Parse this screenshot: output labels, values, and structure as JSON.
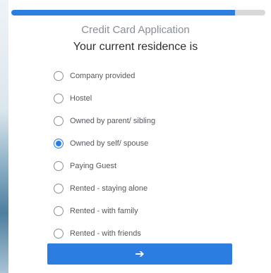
{
  "progress": {
    "fraction": 0.88,
    "color": "#2b7de2"
  },
  "header": {
    "app_title": "Credit Card Application",
    "question": "Your current residence is"
  },
  "options": [
    {
      "label": "Company provided",
      "selected": false
    },
    {
      "label": "Hostel",
      "selected": false
    },
    {
      "label": "Owned by parent/ sibling",
      "selected": false
    },
    {
      "label": "Owned by self/ spouse",
      "selected": true
    },
    {
      "label": "Paying Guest",
      "selected": false
    },
    {
      "label": "Rented - staying alone",
      "selected": false
    },
    {
      "label": "Rented - with family",
      "selected": false
    },
    {
      "label": "Rented - with friends",
      "selected": false
    }
  ],
  "next_button": {
    "icon": "arrow-right-icon",
    "glyph": "➔"
  }
}
